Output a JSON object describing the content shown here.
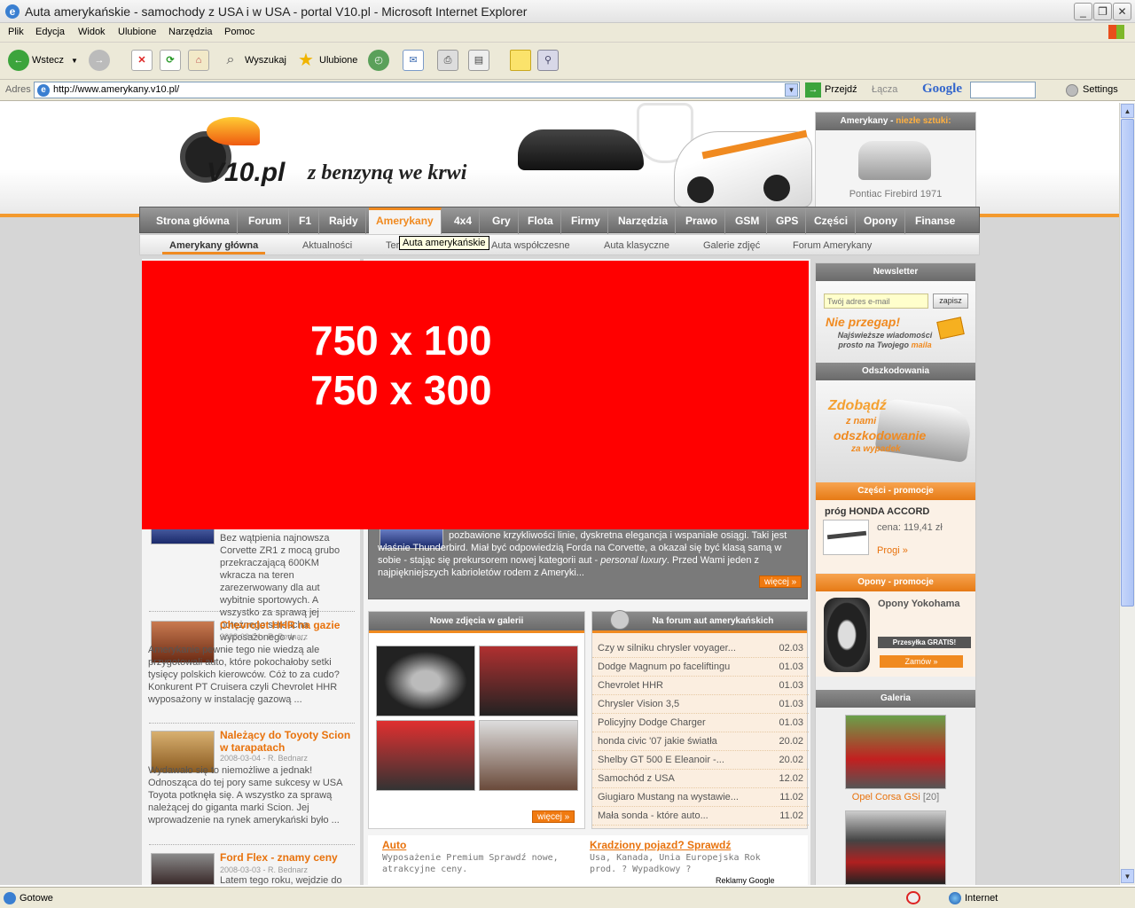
{
  "window": {
    "title": "Auta amerykańskie - samochody z USA i w USA - portal V10.pl - Microsoft Internet Explorer",
    "minimize": "_",
    "maximize": "❐",
    "close": "✕"
  },
  "menu": [
    "Plik",
    "Edycja",
    "Widok",
    "Ulubione",
    "Narzędzia",
    "Pomoc"
  ],
  "toolbar": {
    "back_label": "Wstecz",
    "search_label": "Wyszukaj",
    "favorites_label": "Ulubione"
  },
  "address": {
    "label": "Adres",
    "url": "http://www.amerykany.v10.pl/",
    "go_label": "Przejdź",
    "links_label": "Łącza",
    "google_label": "Google",
    "settings_label": "Settings"
  },
  "site": {
    "logo": "V10.pl",
    "slogan": "z benzyną we krwi",
    "promo": {
      "head_prefix": "Amerykany - ",
      "head_highlight": "niezłe sztuki:",
      "caption": "Pontiac Firebird 1971"
    },
    "nav": [
      "Strona główna",
      "Forum",
      "F1",
      "Rajdy",
      "Amerykany",
      "4x4",
      "Gry",
      "Flota",
      "Firmy",
      "Narzędzia",
      "Prawo",
      "GSM",
      "GPS",
      "Części",
      "Opony",
      "Finanse"
    ],
    "subnav": [
      "Amerykany główna",
      "Aktualności",
      "Ter",
      "Auta współczesne",
      "Auta klasyczne",
      "Galerie zdjęć",
      "Forum Amerykany"
    ],
    "tooltip": "Auta amerykańskie",
    "banner": {
      "line1": "750 x 100",
      "line2": "750 x 300"
    },
    "articles": [
      {
        "title": "",
        "meta": "",
        "body": "Bez wątpienia najnowsza Corvette ZR1 z mocą grubo przekraczającą 600KM wkracza na teren zarezerwowany dla aut wybitnie sportowych. A wszystko za sprawą jej potężnego serducha wyposażonego w ..."
      },
      {
        "title": "Chevrolet HHR na gazie",
        "meta": "2008-03-04 - R. Bednarz",
        "body": "Amerykanie pewnie tego nie wiedzą ale przygotowali auto, które pokochałoby setki tysięcy polskich kierowców. Cóż to za cudo? Konkurent PT Cruisera czyli Chevrolet HHR wyposażony w instalację gazową ..."
      },
      {
        "title": "Należący do Toyoty Scion w tarapatach",
        "meta": "2008-03-04 - R. Bednarz",
        "body": "Wydawało się to niemożliwe a jednak! Odnosząca do tej pory same sukcesy w USA Toyota potknęła się. A wszystko za sprawą należącej do giganta marki Scion. Jej wprowadzenie na rynek amerykański było ..."
      },
      {
        "title": "Ford Flex - znamy ceny",
        "meta": "2008-03-03 - R. Bednarz",
        "body": "Latem tego roku, wejdzie do"
      }
    ],
    "feature": {
      "body": "pozbawione krzykliwości linie, dyskretna elegancja i wspaniałe osiągi. Taki jest właśnie Thunderbird. Miał być odpowiedzią Forda na Corvette, a okazał się być klasą samą w sobie - stając się prekursorem nowej kategorii aut - ",
      "italic": "personal luxury",
      "body2": ". Przed Wami jeden z najpiękniejszych kabrioletów rodem z Ameryki...",
      "more": "więcej »"
    },
    "gallery_box": {
      "title": "Nowe zdjęcia w galerii",
      "more": "więcej »"
    },
    "forum_box": {
      "title": "Na forum aut amerykańskich",
      "rows": [
        {
          "t": "Czy w silniku chrysler voyager...",
          "d": "02.03"
        },
        {
          "t": "Dodge Magnum po faceliftingu",
          "d": "01.03"
        },
        {
          "t": "Chevrolet HHR",
          "d": "01.03"
        },
        {
          "t": "Chrysler Vision 3,5",
          "d": "01.03"
        },
        {
          "t": "Policyjny Dodge Charger",
          "d": "01.03"
        },
        {
          "t": "honda civic '07 jakie światła",
          "d": "20.02"
        },
        {
          "t": "Shelby GT 500 E Eleanoir -...",
          "d": "20.02"
        },
        {
          "t": "Samochód z USA",
          "d": "12.02"
        },
        {
          "t": "Giugiaro Mustang na wystawie...",
          "d": "11.02"
        },
        {
          "t": "Mała sonda - które auto...",
          "d": "11.02"
        }
      ]
    },
    "ads": [
      {
        "title": "Auto",
        "body": "Wyposażenie Premium Sprawdź nowe, atrakcyjne ceny."
      },
      {
        "title": "Kradziony pojazd? Sprawdź",
        "body": "Usa, Kanada, Unia Europejska Rok prod. ? Wypadkowy ?"
      }
    ],
    "ads_by": "Reklamy Google",
    "sidebar": {
      "newsletter_title": "Newsletter",
      "newsletter_placeholder": "Twój adres e-mail",
      "newsletter_button": "zapisz",
      "newsletter_promo1": "Nie przegap!",
      "newsletter_promo2": "Najświeższe wiadomości prosto na Twojego",
      "newsletter_promo3": "maila",
      "comp_title": "Odszkodowania",
      "comp_line1": "Zdobądź",
      "comp_line2": "z nami",
      "comp_line3": "odszkodowanie",
      "comp_line4": "za wypadek",
      "parts_title": "Części - promocje",
      "parts_product": "próg HONDA ACCORD",
      "parts_price": "cena: 119,41 zł",
      "parts_link": "Progi »",
      "tires_title": "Opony - promocje",
      "tires_product": "Opony Yokohama",
      "tires_free": "Przesyłka GRATIS!",
      "tires_order": "Zamów »",
      "gallery_title": "Galeria",
      "gallery_caption": "Opel Corsa GSi",
      "gallery_count": "[20]"
    }
  },
  "status": {
    "text": "Gotowe",
    "zone": "Internet"
  },
  "colors": {
    "accent": "#f07a10",
    "banner": "#ff0000",
    "nav": "#777777"
  }
}
